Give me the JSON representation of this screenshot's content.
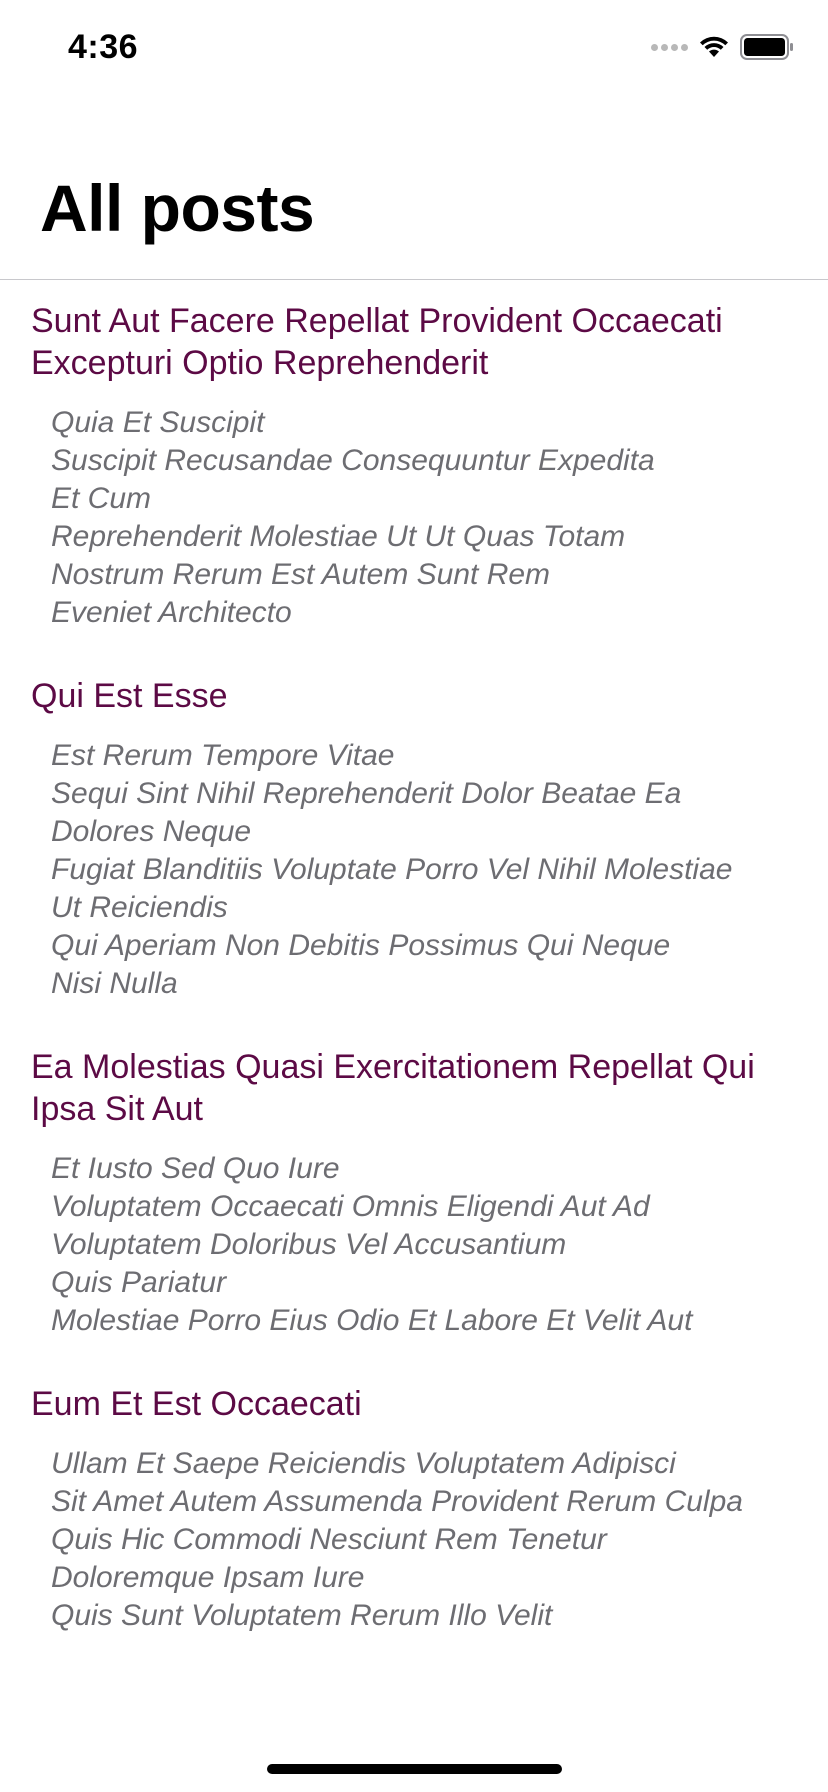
{
  "status_bar": {
    "time": "4:36",
    "icons": [
      "signal-icon",
      "wifi-icon",
      "battery-icon"
    ]
  },
  "header": {
    "title": "All posts"
  },
  "colors": {
    "title": "#5c0a45",
    "body": "#6d6d72"
  },
  "posts": [
    {
      "title": "Sunt Aut Facere Repellat Provident Occaecati Excepturi Optio Reprehenderit",
      "body_lines": [
        "Quia Et Suscipit",
        "Suscipit Recusandae Consequuntur Expedita",
        "Et Cum",
        "Reprehenderit Molestiae Ut Ut Quas Totam",
        "Nostrum Rerum Est Autem Sunt Rem",
        "Eveniet Architecto"
      ]
    },
    {
      "title": "Qui Est Esse",
      "body_lines": [
        "Est Rerum Tempore Vitae",
        "Sequi Sint Nihil Reprehenderit Dolor Beatae Ea",
        "Dolores Neque",
        "Fugiat Blanditiis Voluptate Porro Vel Nihil Molestiae",
        "Ut Reiciendis",
        "Qui Aperiam Non Debitis Possimus Qui Neque",
        "Nisi Nulla"
      ]
    },
    {
      "title": "Ea Molestias Quasi Exercitationem Repellat Qui Ipsa Sit Aut",
      "body_lines": [
        "Et Iusto Sed Quo Iure",
        "Voluptatem Occaecati Omnis Eligendi Aut Ad",
        "Voluptatem Doloribus Vel Accusantium",
        "Quis Pariatur",
        "Molestiae Porro Eius Odio Et Labore Et Velit Aut"
      ]
    },
    {
      "title": "Eum Et Est Occaecati",
      "body_lines": [
        "Ullam Et Saepe Reiciendis Voluptatem Adipisci",
        "Sit Amet Autem Assumenda Provident Rerum Culpa",
        "Quis Hic Commodi Nesciunt Rem Tenetur",
        "Doloremque Ipsam Iure",
        "Quis Sunt Voluptatem Rerum Illo Velit"
      ]
    }
  ]
}
